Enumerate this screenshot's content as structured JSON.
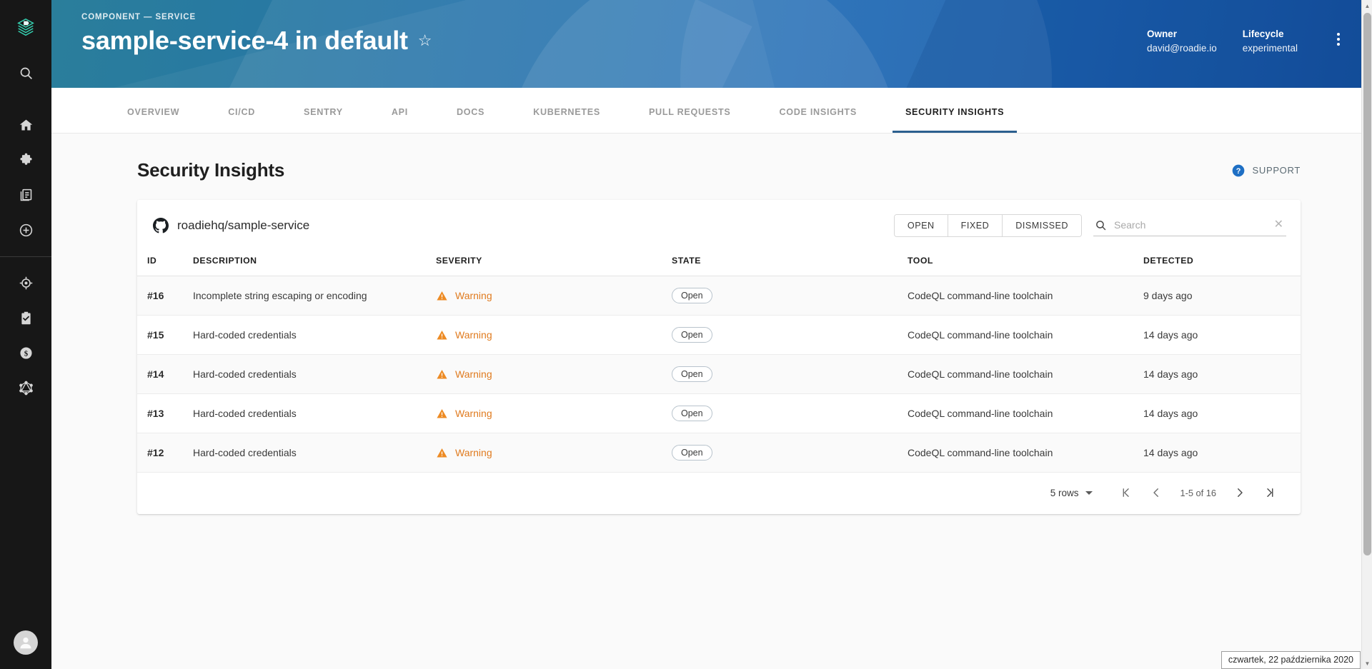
{
  "sidebar": {
    "logo_icon": "roadie-stack-logo",
    "items": [
      {
        "icon": "search-icon",
        "name": "search"
      },
      {
        "icon": "home-icon",
        "name": "home"
      },
      {
        "icon": "puzzle-icon",
        "name": "plugins"
      },
      {
        "icon": "docs-icon",
        "name": "docs"
      },
      {
        "icon": "plus-circle-icon",
        "name": "create"
      },
      {
        "icon": "target-icon",
        "name": "tech-radar"
      },
      {
        "icon": "clipboard-check-icon",
        "name": "tech-checks"
      },
      {
        "icon": "dollar-circle-icon",
        "name": "cost-insights"
      },
      {
        "icon": "graphql-icon",
        "name": "graphiql"
      }
    ],
    "avatar_icon": "user-avatar"
  },
  "header": {
    "breadcrumb": "COMPONENT — SERVICE",
    "title": "sample-service-4 in default",
    "star_icon": "star-outline-icon",
    "fields": [
      {
        "label": "Owner",
        "value": "david@roadie.io"
      },
      {
        "label": "Lifecycle",
        "value": "experimental"
      }
    ],
    "menu_icon": "kebab-menu-icon",
    "accent_color": "#1f6bb5"
  },
  "tabs": [
    {
      "label": "OVERVIEW",
      "active": false
    },
    {
      "label": "CI/CD",
      "active": false
    },
    {
      "label": "SENTRY",
      "active": false
    },
    {
      "label": "API",
      "active": false
    },
    {
      "label": "DOCS",
      "active": false
    },
    {
      "label": "KUBERNETES",
      "active": false
    },
    {
      "label": "PULL REQUESTS",
      "active": false
    },
    {
      "label": "CODE INSIGHTS",
      "active": false
    },
    {
      "label": "SECURITY INSIGHTS",
      "active": true
    }
  ],
  "page": {
    "title": "Security Insights",
    "support_label": "SUPPORT",
    "support_icon": "help-circle-icon"
  },
  "card": {
    "repo_icon": "github-icon",
    "repo_name": "roadiehq/sample-service",
    "filters": [
      {
        "label": "OPEN"
      },
      {
        "label": "FIXED"
      },
      {
        "label": "DISMISSED"
      }
    ],
    "search": {
      "icon": "search-icon",
      "value": "",
      "placeholder": "Search",
      "clear_icon": "close-icon"
    },
    "columns": [
      "ID",
      "DESCRIPTION",
      "SEVERITY",
      "STATE",
      "TOOL",
      "DETECTED"
    ],
    "rows": [
      {
        "id": "#16",
        "description": "Incomplete string escaping or encoding",
        "severity": "Warning",
        "severity_icon": "warning-triangle-icon",
        "state": "Open",
        "tool": "CodeQL command-line toolchain",
        "detected": "9 days ago"
      },
      {
        "id": "#15",
        "description": "Hard-coded credentials",
        "severity": "Warning",
        "severity_icon": "warning-triangle-icon",
        "state": "Open",
        "tool": "CodeQL command-line toolchain",
        "detected": "14 days ago"
      },
      {
        "id": "#14",
        "description": "Hard-coded credentials",
        "severity": "Warning",
        "severity_icon": "warning-triangle-icon",
        "state": "Open",
        "tool": "CodeQL command-line toolchain",
        "detected": "14 days ago"
      },
      {
        "id": "#13",
        "description": "Hard-coded credentials",
        "severity": "Warning",
        "severity_icon": "warning-triangle-icon",
        "state": "Open",
        "tool": "CodeQL command-line toolchain",
        "detected": "14 days ago"
      },
      {
        "id": "#12",
        "description": "Hard-coded credentials",
        "severity": "Warning",
        "severity_icon": "warning-triangle-icon",
        "state": "Open",
        "tool": "CodeQL command-line toolchain",
        "detected": "14 days ago"
      }
    ],
    "pagination": {
      "rows_label": "5 rows",
      "range_label": "1-5 of 16",
      "first_icon": "first-page-icon",
      "prev_icon": "prev-page-icon",
      "next_icon": "next-page-icon",
      "last_icon": "last-page-icon"
    }
  },
  "status_tooltip": "czwartek, 22 października 2020",
  "colors": {
    "warning": "#e07b1f",
    "tab_underline": "#2b5f8f",
    "support_blue": "#1e6fc4"
  }
}
